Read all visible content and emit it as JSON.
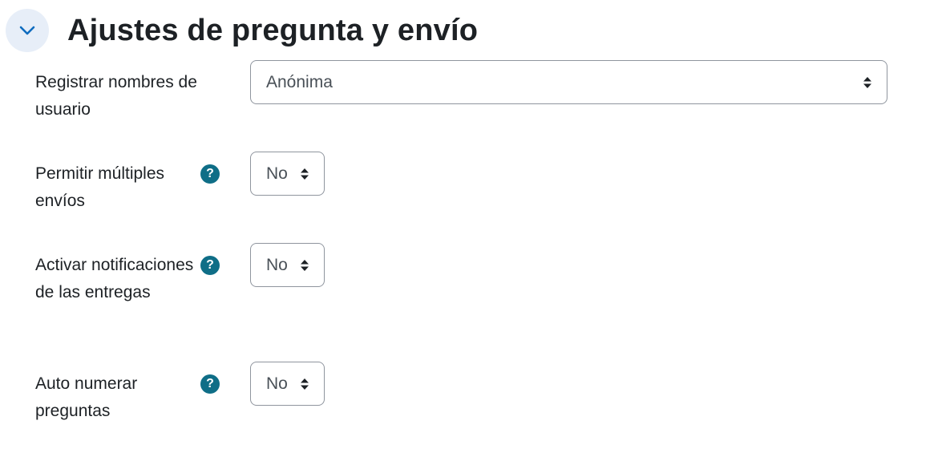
{
  "section": {
    "title": "Ajustes de pregunta y envío"
  },
  "fields": [
    {
      "label": "Registrar nombres de usuario",
      "value": "Anónima",
      "has_help": false
    },
    {
      "label": "Permitir múltiples envíos",
      "value": "No",
      "has_help": true
    },
    {
      "label": "Activar notificaciones de las entregas",
      "value": "No",
      "has_help": true
    },
    {
      "label": "Auto numerar preguntas",
      "value": "No",
      "has_help": true
    }
  ],
  "help_symbol": "?",
  "colors": {
    "help_icon_bg": "#0f6e87",
    "collapse_bg": "#e7eef8",
    "chevron": "#0f6cbf",
    "select_border": "#8f959e"
  }
}
